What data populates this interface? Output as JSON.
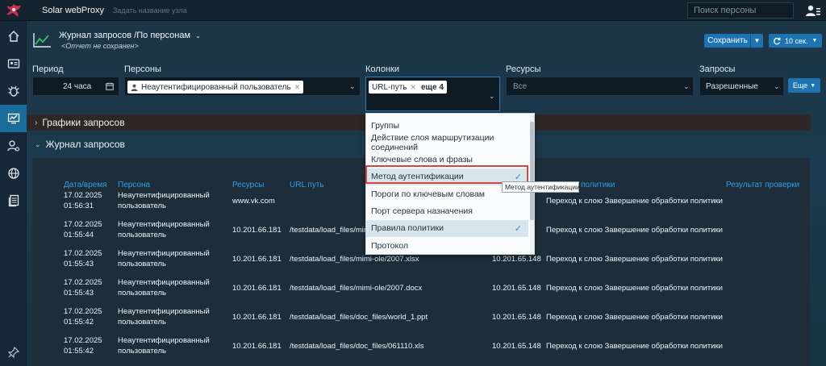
{
  "app": {
    "title": "Solar webProxy",
    "node_placeholder": "Задать название узла"
  },
  "search": {
    "placeholder": "Поиск персоны"
  },
  "sidebar": {
    "items": [
      {
        "icon": "home-icon"
      },
      {
        "icon": "id-card-icon"
      },
      {
        "icon": "bug-shield-icon"
      },
      {
        "icon": "monitoring-icon",
        "active": true
      },
      {
        "icon": "user-settings-icon"
      },
      {
        "icon": "globe-icon"
      },
      {
        "icon": "documents-icon"
      },
      {
        "icon": "pin-icon"
      }
    ]
  },
  "report": {
    "title": "Журнал запросов /По персонам",
    "subtitle": "<Отчет не сохранен>",
    "save_label": "Сохранить",
    "refresh_label": "10 сек."
  },
  "filters": {
    "period_label": "Период",
    "period_value": "24 часа",
    "persons_label": "Персоны",
    "person_chip": "Неаутентифицированный пользователь",
    "columns_label": "Колонки",
    "columns_chip": "URL-путь",
    "columns_more": "еще 4",
    "resources_label": "Ресурсы",
    "resources_value": "Все",
    "requests_label": "Запросы",
    "requests_value": "Разрешенные",
    "more_label": "Еще"
  },
  "sections": {
    "charts": "Графики запросов",
    "log": "Журнал запросов"
  },
  "table": {
    "headers": {
      "datetime": "Дата/время",
      "person": "Персона",
      "resources": "Ресурсы",
      "url": "URL путь",
      "policy": "политики",
      "result": "Результат проверки"
    },
    "rows": [
      {
        "date": "17.02.2025",
        "time": "01:56:31",
        "person1": "Неаутентифицированный",
        "person2": "пользователь",
        "resource": "www.vk.com",
        "url": "",
        "ip": "",
        "policy": "Переход к слою Завершение обработки политики"
      },
      {
        "date": "17.02.2025",
        "time": "01:55:44",
        "person1": "Неаутентифицированный",
        "person2": "пользователь",
        "resource": "10.201.66.181",
        "url": "/testdata/load_files/mir",
        "ip": "",
        "policy": "Переход к слою Завершение обработки политики"
      },
      {
        "date": "17.02.2025",
        "time": "01:55:43",
        "person1": "Неаутентифицированный",
        "person2": "пользователь",
        "resource": "10.201.66.181",
        "url": "/testdata/load_files/mimi-ole/2007.xlsx",
        "ip": "10.201.65.148",
        "policy": "Переход к слою Завершение обработки политики"
      },
      {
        "date": "17.02.2025",
        "time": "01:55:43",
        "person1": "Неаутентифицированный",
        "person2": "пользователь",
        "resource": "10.201.66.181",
        "url": "/testdata/load_files/mimi-ole/2007.docx",
        "ip": "10.201.65.148",
        "policy": "Переход к слою Завершение обработки политики"
      },
      {
        "date": "17.02.2025",
        "time": "01:55:42",
        "person1": "Неаутентифицированный",
        "person2": "пользователь",
        "resource": "10.201.66.181",
        "url": "/testdata/load_files/doc_files/world_1.ppt",
        "ip": "10.201.65.148",
        "policy": "Переход к слою Завершение обработки политики"
      },
      {
        "date": "17.02.2025",
        "time": "01:55:42",
        "person1": "Неаутентифицированный",
        "person2": "пользователь",
        "resource": "10.201.66.181",
        "url": "/testdata/load_files/doc_files/061110.xls",
        "ip": "10.201.65.148",
        "policy": "Переход к слою Завершение обработки политики"
      }
    ]
  },
  "columns_dropdown": {
    "items": [
      {
        "label": "Группы",
        "selected": false
      },
      {
        "label": "Действие слоя маршрутизации соединений",
        "selected": false
      },
      {
        "label": "Ключевые слова и фразы",
        "selected": false
      },
      {
        "label": "Метод аутентификации",
        "selected": true
      },
      {
        "label": "Пороги по ключевым словам",
        "selected": false
      },
      {
        "label": "Порт сервера назначения",
        "selected": false
      },
      {
        "label": "Правила политики",
        "selected": true
      },
      {
        "label": "Протокол",
        "selected": false
      }
    ],
    "tooltip": "Метод аутентификации"
  },
  "colors": {
    "accent": "#1d74b3",
    "header_link": "#2f9ee6",
    "highlight_border": "#d9453e",
    "check": "#2d8fd0"
  }
}
